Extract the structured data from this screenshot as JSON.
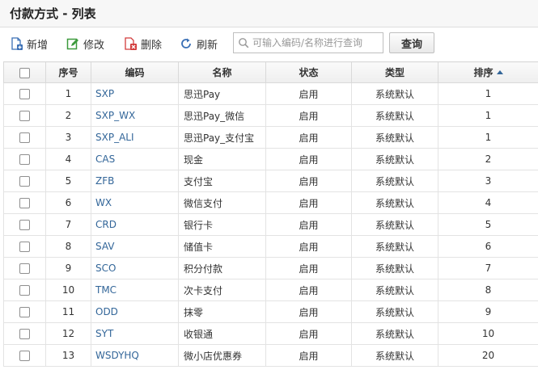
{
  "header": {
    "title": "付款方式 - 列表"
  },
  "toolbar": {
    "add_label": "新增",
    "edit_label": "修改",
    "delete_label": "删除",
    "refresh_label": "刷新",
    "search_placeholder": "可输入编码/名称进行查询",
    "query_label": "查询"
  },
  "table": {
    "columns": {
      "seq": "序号",
      "code": "编码",
      "name": "名称",
      "status": "状态",
      "type": "类型",
      "order": "排序"
    },
    "sort": {
      "column": "order",
      "direction": "ascending",
      "indicator_color": "#336699"
    },
    "rows": [
      {
        "seq": "1",
        "code": "SXP",
        "name": "思迅Pay",
        "status": "启用",
        "type": "系统默认",
        "order": "1"
      },
      {
        "seq": "2",
        "code": "SXP_WX",
        "name": "思迅Pay_微信",
        "status": "启用",
        "type": "系统默认",
        "order": "1"
      },
      {
        "seq": "3",
        "code": "SXP_ALI",
        "name": "思迅Pay_支付宝",
        "status": "启用",
        "type": "系统默认",
        "order": "1"
      },
      {
        "seq": "4",
        "code": "CAS",
        "name": "现金",
        "status": "启用",
        "type": "系统默认",
        "order": "2"
      },
      {
        "seq": "5",
        "code": "ZFB",
        "name": "支付宝",
        "status": "启用",
        "type": "系统默认",
        "order": "3"
      },
      {
        "seq": "6",
        "code": "WX",
        "name": "微信支付",
        "status": "启用",
        "type": "系统默认",
        "order": "4"
      },
      {
        "seq": "7",
        "code": "CRD",
        "name": "银行卡",
        "status": "启用",
        "type": "系统默认",
        "order": "5"
      },
      {
        "seq": "8",
        "code": "SAV",
        "name": "储值卡",
        "status": "启用",
        "type": "系统默认",
        "order": "6"
      },
      {
        "seq": "9",
        "code": "SCO",
        "name": "积分付款",
        "status": "启用",
        "type": "系统默认",
        "order": "7"
      },
      {
        "seq": "10",
        "code": "TMC",
        "name": "次卡支付",
        "status": "启用",
        "type": "系统默认",
        "order": "8"
      },
      {
        "seq": "11",
        "code": "ODD",
        "name": "抹零",
        "status": "启用",
        "type": "系统默认",
        "order": "9"
      },
      {
        "seq": "12",
        "code": "SYT",
        "name": "收银通",
        "status": "启用",
        "type": "系统默认",
        "order": "10"
      },
      {
        "seq": "13",
        "code": "WSDYHQ",
        "name": "微小店优惠券",
        "status": "启用",
        "type": "系统默认",
        "order": "20"
      }
    ]
  },
  "colors": {
    "link": "#336699",
    "add_icon": "#3a6fb5",
    "edit_icon": "#3c9a3c",
    "delete_icon": "#d23b3b",
    "refresh_icon": "#3a6fb5"
  },
  "icons": {
    "add": "add-doc-icon",
    "edit": "edit-doc-icon",
    "delete": "delete-doc-icon",
    "refresh": "refresh-icon",
    "search": "search-icon"
  }
}
